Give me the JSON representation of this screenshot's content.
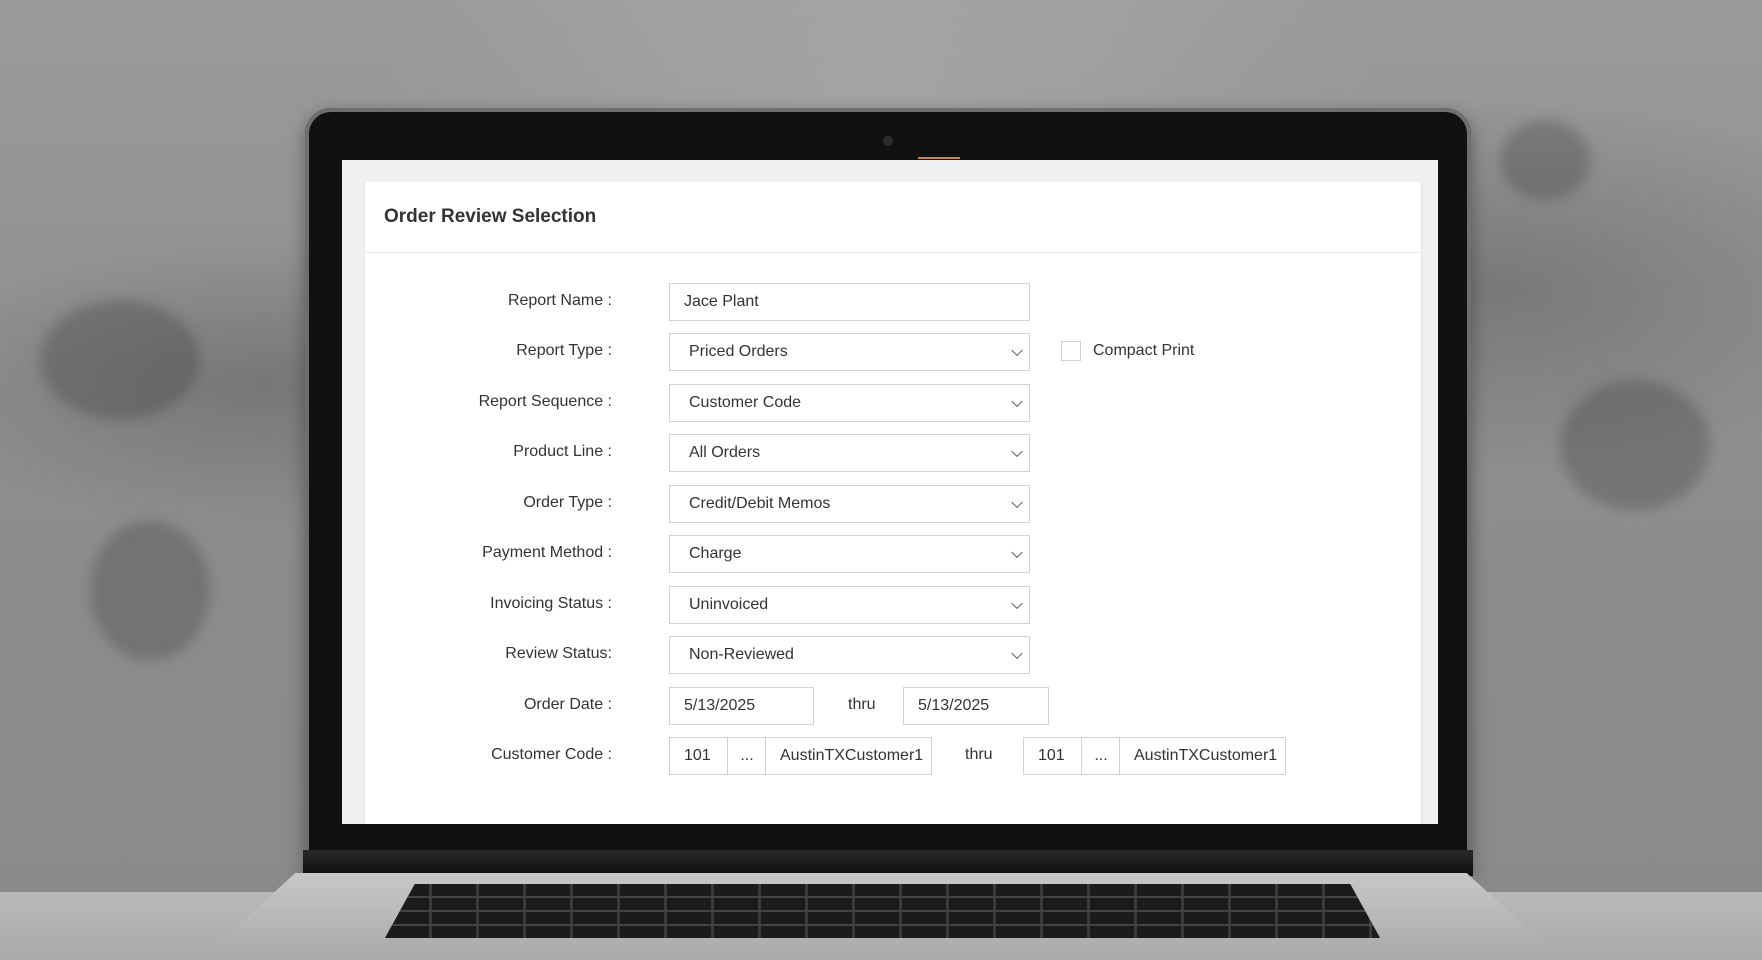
{
  "panel": {
    "title": "Order Review Selection"
  },
  "form": {
    "report_name": {
      "label": "Report Name :",
      "value": "Jace Plant"
    },
    "report_type": {
      "label": "Report Type :",
      "value": "Priced Orders"
    },
    "compact_print": {
      "label": "Compact Print",
      "checked": false
    },
    "report_sequence": {
      "label": "Report Sequence :",
      "value": "Customer Code"
    },
    "product_line": {
      "label": "Product Line :",
      "value": "All Orders"
    },
    "order_type": {
      "label": "Order Type :",
      "value": "Credit/Debit Memos"
    },
    "payment_method": {
      "label": "Payment Method :",
      "value": "Charge"
    },
    "invoicing_status": {
      "label": "Invoicing Status :",
      "value": "Uninvoiced"
    },
    "review_status": {
      "label": "Review Status:",
      "value": "Non-Reviewed"
    },
    "order_date": {
      "label": "Order Date :",
      "from": "5/13/2025",
      "thru_label": "thru",
      "to": "5/13/2025"
    },
    "customer_code": {
      "label": "Customer Code :",
      "from_code": "101",
      "from_lookup": "...",
      "from_name": "AustinTXCustomer1",
      "thru_label": "thru",
      "to_code": "101",
      "to_lookup": "...",
      "to_name": "AustinTXCustomer1"
    }
  }
}
